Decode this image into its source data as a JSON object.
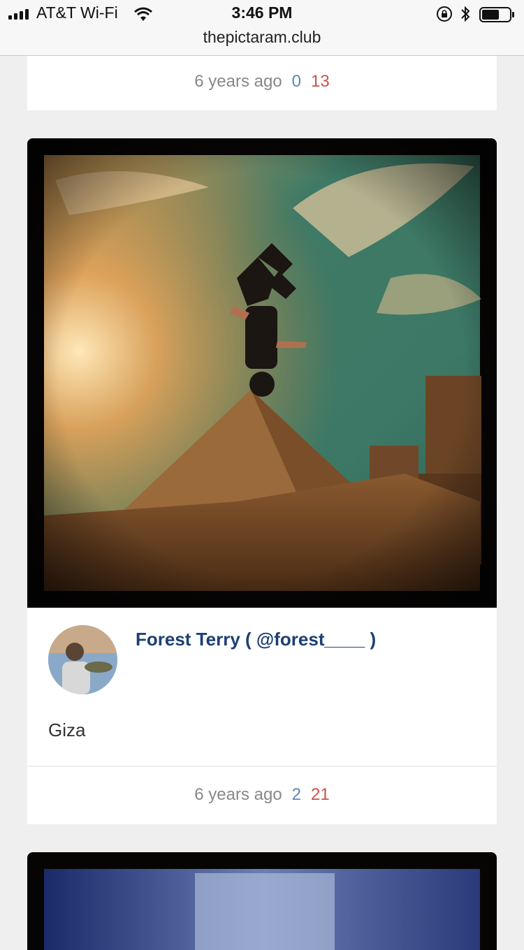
{
  "status_bar": {
    "carrier": "AT&T Wi-Fi",
    "time": "3:46 PM",
    "url": "thepictaram.club"
  },
  "posts": [
    {
      "time_ago": "6 years ago",
      "comments": "0",
      "likes": "13"
    },
    {
      "author": "Forest Terry ( @forest____ )",
      "caption": "Giza",
      "time_ago": "6 years ago",
      "comments": "2",
      "likes": "21"
    }
  ],
  "icons": [
    "signal-icon",
    "wifi-icon",
    "orientation-lock-icon",
    "bluetooth-icon",
    "battery-icon"
  ],
  "colors": {
    "author": "#1d3f73",
    "comments": "#5d86b3",
    "likes": "#c9524a",
    "background": "#efefef"
  }
}
